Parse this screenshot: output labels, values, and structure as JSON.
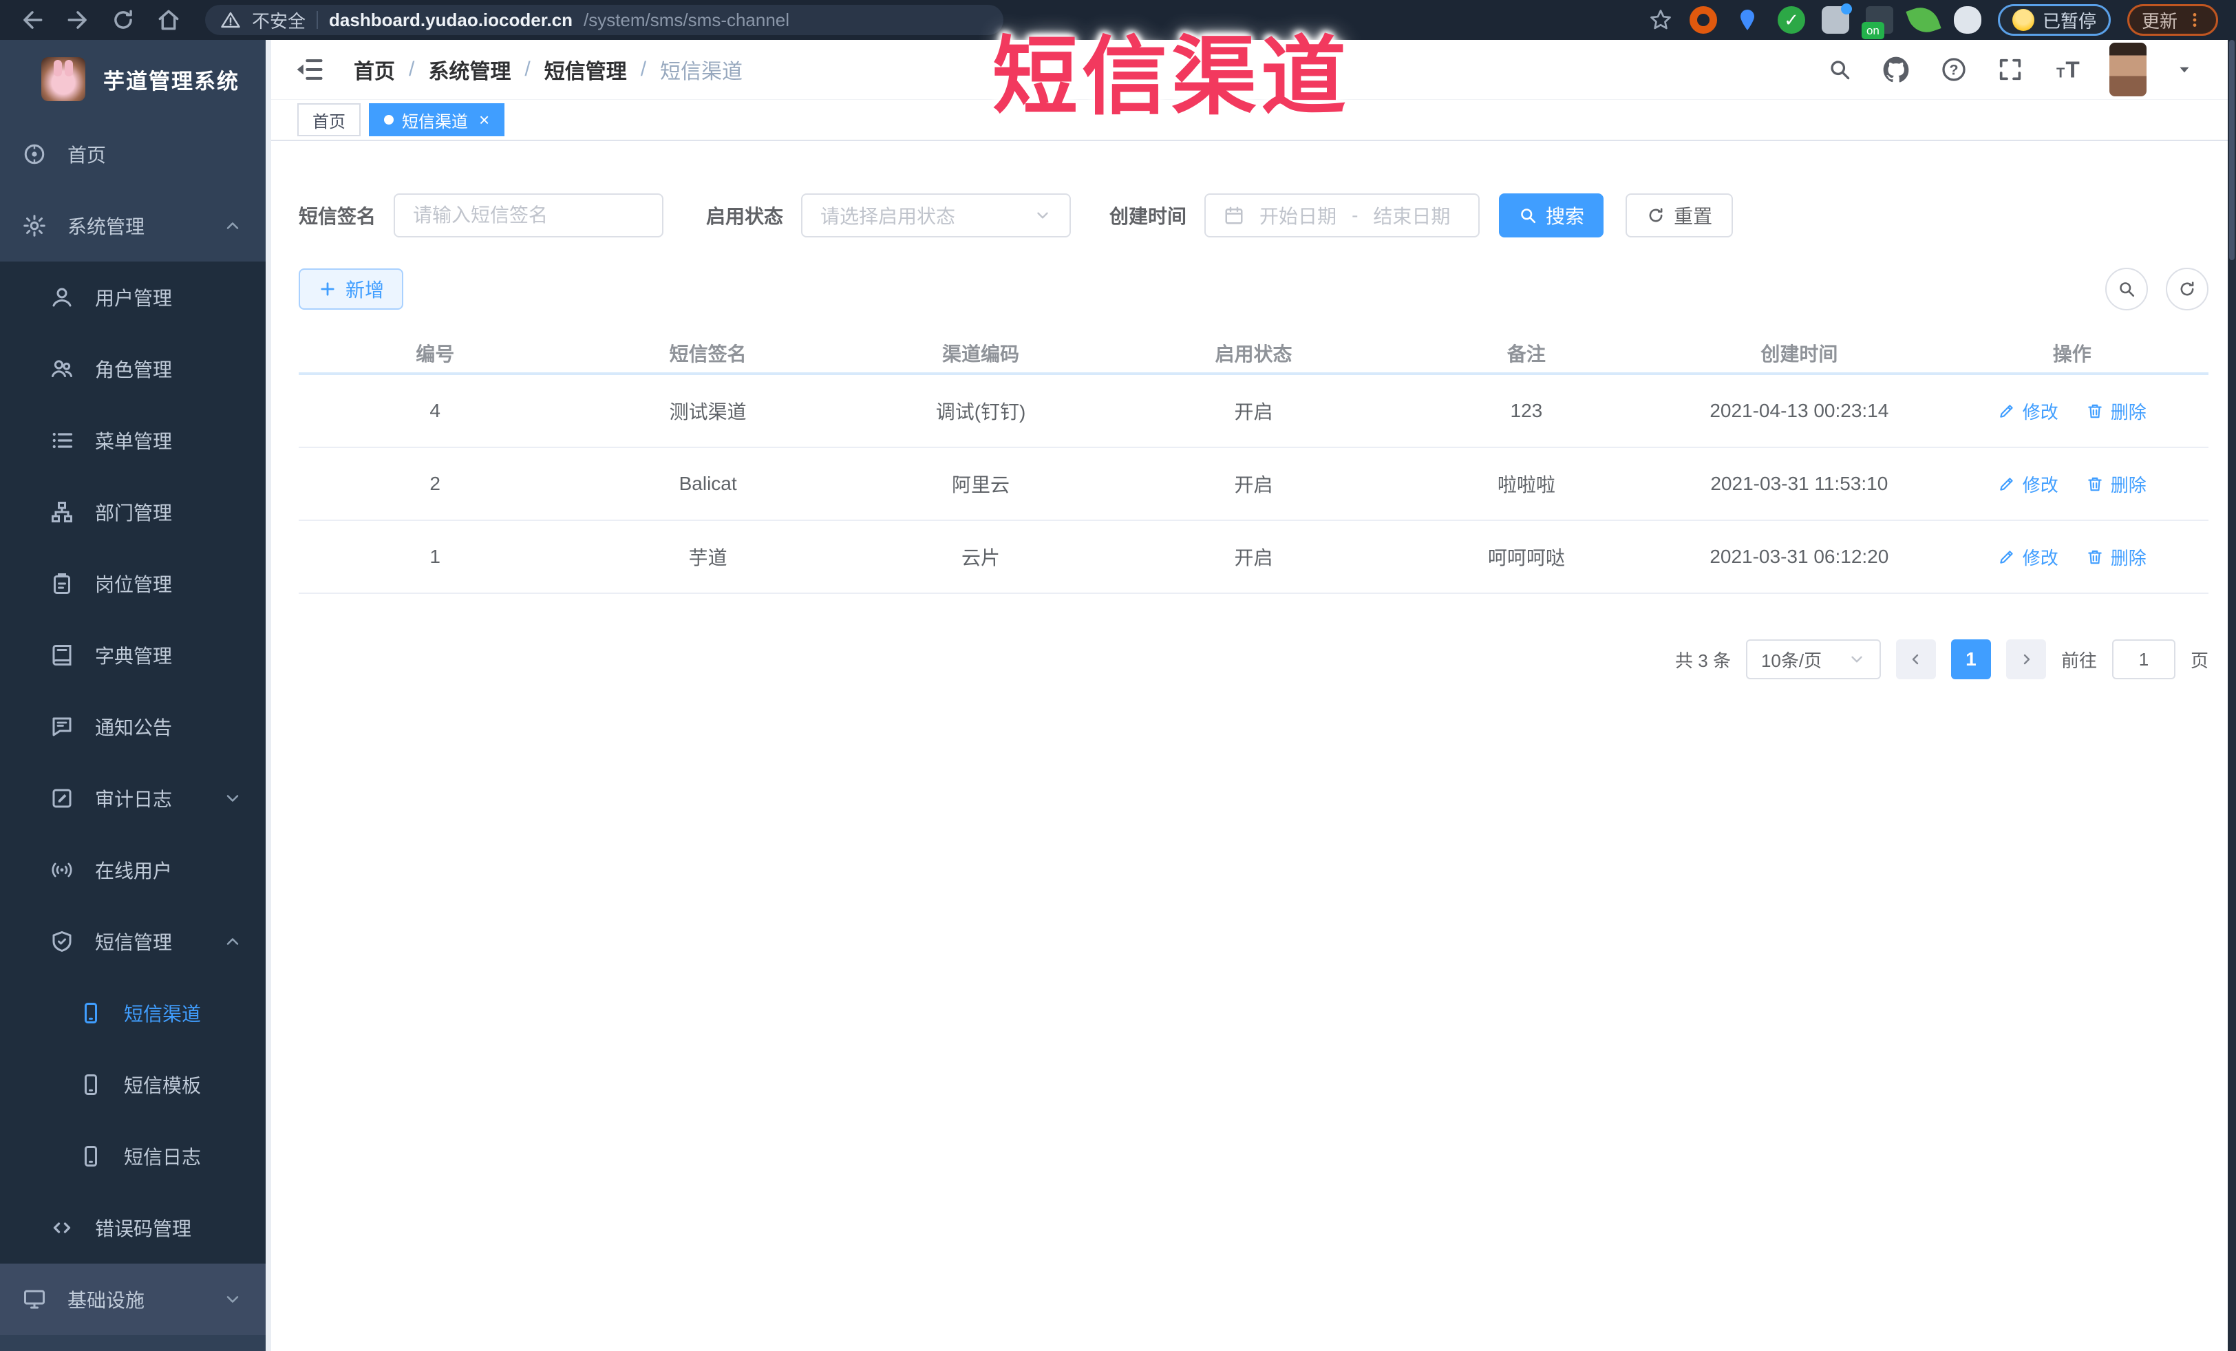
{
  "browser": {
    "security_label": "不安全",
    "url_host": "dashboard.yudao.iocoder.cn",
    "url_path": "/system/sms/sms-channel",
    "paused_label": "已暂停",
    "update_label": "更新"
  },
  "overlay_title": "短信渠道",
  "sidebar": {
    "app_title": "芋道管理系统",
    "items": [
      {
        "label": "首页"
      },
      {
        "label": "系统管理"
      },
      {
        "label": "用户管理"
      },
      {
        "label": "角色管理"
      },
      {
        "label": "菜单管理"
      },
      {
        "label": "部门管理"
      },
      {
        "label": "岗位管理"
      },
      {
        "label": "字典管理"
      },
      {
        "label": "通知公告"
      },
      {
        "label": "审计日志"
      },
      {
        "label": "在线用户"
      },
      {
        "label": "短信管理"
      },
      {
        "label": "短信渠道"
      },
      {
        "label": "短信模板"
      },
      {
        "label": "短信日志"
      },
      {
        "label": "错误码管理"
      },
      {
        "label": "基础设施"
      }
    ]
  },
  "breadcrumb": {
    "items": [
      "首页",
      "系统管理",
      "短信管理",
      "短信渠道"
    ],
    "separator": "/"
  },
  "tabs": [
    {
      "label": "首页"
    },
    {
      "label": "短信渠道",
      "close": "×"
    }
  ],
  "filters": {
    "sign_label": "短信签名",
    "sign_placeholder": "请输入短信签名",
    "status_label": "启用状态",
    "status_placeholder": "请选择启用状态",
    "time_label": "创建时间",
    "start_placeholder": "开始日期",
    "range_separator": "-",
    "end_placeholder": "结束日期",
    "search_label": "搜索",
    "reset_label": "重置"
  },
  "actions": {
    "add_label": "新增"
  },
  "table": {
    "columns": [
      "编号",
      "短信签名",
      "渠道编码",
      "启用状态",
      "备注",
      "创建时间",
      "操作"
    ],
    "edit_label": "修改",
    "delete_label": "删除",
    "rows": [
      {
        "id": "4",
        "sign": "测试渠道",
        "code": "调试(钉钉)",
        "status": "开启",
        "remark": "123",
        "created": "2021-04-13 00:23:14"
      },
      {
        "id": "2",
        "sign": "Balicat",
        "code": "阿里云",
        "status": "开启",
        "remark": "啦啦啦",
        "created": "2021-03-31 11:53:10"
      },
      {
        "id": "1",
        "sign": "芋道",
        "code": "云片",
        "status": "开启",
        "remark": "呵呵呵哒",
        "created": "2021-03-31 06:12:20"
      }
    ]
  },
  "pagination": {
    "total": "共 3 条",
    "page_size": "10条/页",
    "current": "1",
    "goto_label": "前往",
    "goto_value": "1",
    "page_unit": "页"
  },
  "colors": {
    "accent": "#409eff",
    "overlay_red": "#f2395e",
    "sidebar_bg": "#314157",
    "submenu_bg": "#1f2d3d",
    "toolbar_bg": "#1c2634"
  }
}
